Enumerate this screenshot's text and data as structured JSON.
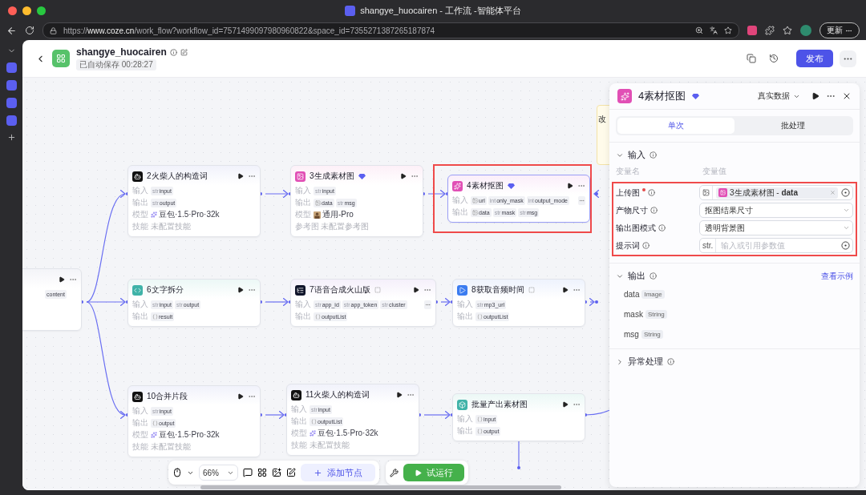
{
  "window": {
    "title": "shangye_huocairen - 工作流 -智能体平台"
  },
  "browser": {
    "url": "https://**www.coze.cn**/work_flow?workflow_id=7571499097980960822&space_id=7355271387265187874",
    "update_button": "更新"
  },
  "app_header": {
    "title": "shangye_huocairen",
    "autosave": "已自动保存 00:28:27",
    "publish_button": "发布"
  },
  "note": {
    "text": "改"
  },
  "nodes": [
    {
      "kind": "partial",
      "selected": false,
      "highlighted": false,
      "rows": [
        {
          "kind": "tags",
          "more": false,
          "tags": [
            {
              "kind": "plain",
              "name": "content"
            }
          ]
        }
      ]
    },
    {
      "kind": "full",
      "title": "2火柴人的构造词",
      "selected": false,
      "highlighted": false,
      "rows": [
        {
          "kind": "tags",
          "label": "输入",
          "more": false,
          "tags": [
            {
              "kind": "text",
              "prefix": "str",
              "name": "input"
            }
          ]
        },
        {
          "kind": "tags",
          "label": "输出",
          "more": false,
          "tags": [
            {
              "kind": "text",
              "prefix": "str",
              "name": "output"
            }
          ]
        },
        {
          "kind": "model",
          "label": "模型",
          "value": "豆包·1.5·Pro·32k"
        },
        {
          "kind": "muted",
          "label": "技能",
          "value": "未配置技能"
        }
      ]
    },
    {
      "kind": "full",
      "title": "3生成素材图",
      "selected": false,
      "highlighted": false,
      "rows": [
        {
          "kind": "tags",
          "label": "输入",
          "more": false,
          "tags": [
            {
              "kind": "text",
              "prefix": "str",
              "name": "input"
            }
          ]
        },
        {
          "kind": "tags",
          "label": "输出",
          "more": false,
          "tags": [
            {
              "kind": "image",
              "name": "data"
            },
            {
              "kind": "text",
              "prefix": "str",
              "name": "msg"
            }
          ]
        },
        {
          "kind": "avatar",
          "label": "模型",
          "value": "通用-Pro"
        },
        {
          "kind": "muted",
          "label": "参考图",
          "value": "未配置参考图"
        }
      ]
    },
    {
      "kind": "full",
      "title": "4素材抠图",
      "selected": true,
      "highlighted": true,
      "rows": [
        {
          "kind": "tags",
          "label": "输入",
          "more": true,
          "tags": [
            {
              "kind": "image",
              "name": "url"
            },
            {
              "kind": "text",
              "prefix": "int",
              "name": "only_mask"
            },
            {
              "kind": "text",
              "prefix": "int",
              "name": "output_mode"
            }
          ]
        },
        {
          "kind": "tags",
          "label": "输出",
          "more": false,
          "tags": [
            {
              "kind": "image",
              "name": "data"
            },
            {
              "kind": "text",
              "prefix": "str",
              "name": "mask"
            },
            {
              "kind": "text",
              "prefix": "str",
              "name": "msg"
            }
          ]
        }
      ]
    },
    {
      "kind": "full",
      "title": "6文字拆分",
      "selected": false,
      "highlighted": false,
      "rows": [
        {
          "kind": "tags",
          "label": "输入",
          "more": false,
          "tags": [
            {
              "kind": "text",
              "prefix": "str",
              "name": "input"
            },
            {
              "kind": "text",
              "prefix": "str",
              "name": "output"
            }
          ]
        },
        {
          "kind": "tags",
          "label": "输出",
          "more": false,
          "tags": [
            {
              "kind": "list",
              "name": "result"
            }
          ]
        }
      ]
    },
    {
      "kind": "full",
      "title": "7语音合成火山版",
      "selected": false,
      "highlighted": false,
      "rows": [
        {
          "kind": "tags",
          "label": "输入",
          "more": true,
          "tags": [
            {
              "kind": "text",
              "prefix": "str",
              "name": "app_id"
            },
            {
              "kind": "text",
              "prefix": "str",
              "name": "app_token"
            },
            {
              "kind": "text",
              "prefix": "str",
              "name": "cluster"
            }
          ]
        },
        {
          "kind": "tags",
          "label": "输出",
          "more": false,
          "tags": [
            {
              "kind": "list",
              "name": "outputList"
            }
          ]
        }
      ]
    },
    {
      "kind": "full",
      "title": "8获取音频时间",
      "selected": false,
      "highlighted": false,
      "rows": [
        {
          "kind": "tags",
          "label": "输入",
          "more": false,
          "tags": [
            {
              "kind": "text",
              "prefix": "str",
              "name": "mp3_url"
            }
          ]
        },
        {
          "kind": "tags",
          "label": "输出",
          "more": false,
          "tags": [
            {
              "kind": "list",
              "name": "outputList"
            }
          ]
        }
      ]
    },
    {
      "kind": "full",
      "title": "10合并片段",
      "selected": false,
      "highlighted": false,
      "rows": [
        {
          "kind": "tags",
          "label": "输入",
          "more": false,
          "tags": [
            {
              "kind": "text",
              "prefix": "str",
              "name": "input"
            }
          ]
        },
        {
          "kind": "tags",
          "label": "输出",
          "more": false,
          "tags": [
            {
              "kind": "list",
              "name": "output"
            }
          ]
        },
        {
          "kind": "model",
          "label": "模型",
          "value": "豆包·1.5·Pro·32k"
        },
        {
          "kind": "muted",
          "label": "技能",
          "value": "未配置技能"
        }
      ]
    },
    {
      "kind": "full",
      "title": "11火柴人的构造词",
      "selected": false,
      "highlighted": false,
      "rows": [
        {
          "kind": "tags",
          "label": "输入",
          "more": false,
          "tags": [
            {
              "kind": "text",
              "prefix": "str",
              "name": "input"
            }
          ]
        },
        {
          "kind": "tags",
          "label": "输出",
          "more": false,
          "tags": [
            {
              "kind": "list",
              "name": "outputList"
            }
          ]
        },
        {
          "kind": "model",
          "label": "模型",
          "value": "豆包·1.5·Pro·32k"
        },
        {
          "kind": "muted",
          "label": "技能",
          "value": "未配置技能"
        }
      ]
    },
    {
      "kind": "full",
      "title": "批量产出素材图",
      "selected": false,
      "highlighted": false,
      "rows": [
        {
          "kind": "tags",
          "label": "输入",
          "more": false,
          "tags": [
            {
              "kind": "list",
              "name": "input"
            }
          ]
        },
        {
          "kind": "tags",
          "label": "输出",
          "more": false,
          "tags": [
            {
              "kind": "list",
              "name": "output"
            }
          ]
        }
      ]
    }
  ],
  "toolbar": {
    "zoom": "66%",
    "add_node_button": "添加节点",
    "test_run_button": "试运行"
  },
  "panel": {
    "title": "4素材抠图",
    "data_source": "真实数据",
    "tabs": [
      {
        "label": "单次",
        "selected": true
      },
      {
        "label": "批处理",
        "selected": false
      }
    ],
    "input_section": {
      "title": "输入",
      "expanded": true,
      "col_name": "变量名",
      "col_value": "变量值",
      "highlighted": true,
      "rows": [
        {
          "name": "上传图",
          "required": true,
          "kind": "reference",
          "ref": "3生成素材图 - **data**"
        },
        {
          "name": "产物尺寸",
          "required": false,
          "kind": "select",
          "value": "抠图结果尺寸"
        },
        {
          "name": "输出图模式",
          "required": false,
          "kind": "select",
          "value": "透明背景图"
        },
        {
          "name": "提示词",
          "required": false,
          "kind": "input",
          "prefix": "str.",
          "placeholder": "输入或引用参数值"
        }
      ]
    },
    "output_section": {
      "title": "输出",
      "expanded": true,
      "link": "查看示例",
      "rows": [
        {
          "name": "data",
          "type": "Image"
        },
        {
          "name": "mask",
          "type": "String"
        },
        {
          "name": "msg",
          "type": "String"
        }
      ]
    },
    "error_section": {
      "title": "异常处理",
      "expanded": false
    }
  }
}
